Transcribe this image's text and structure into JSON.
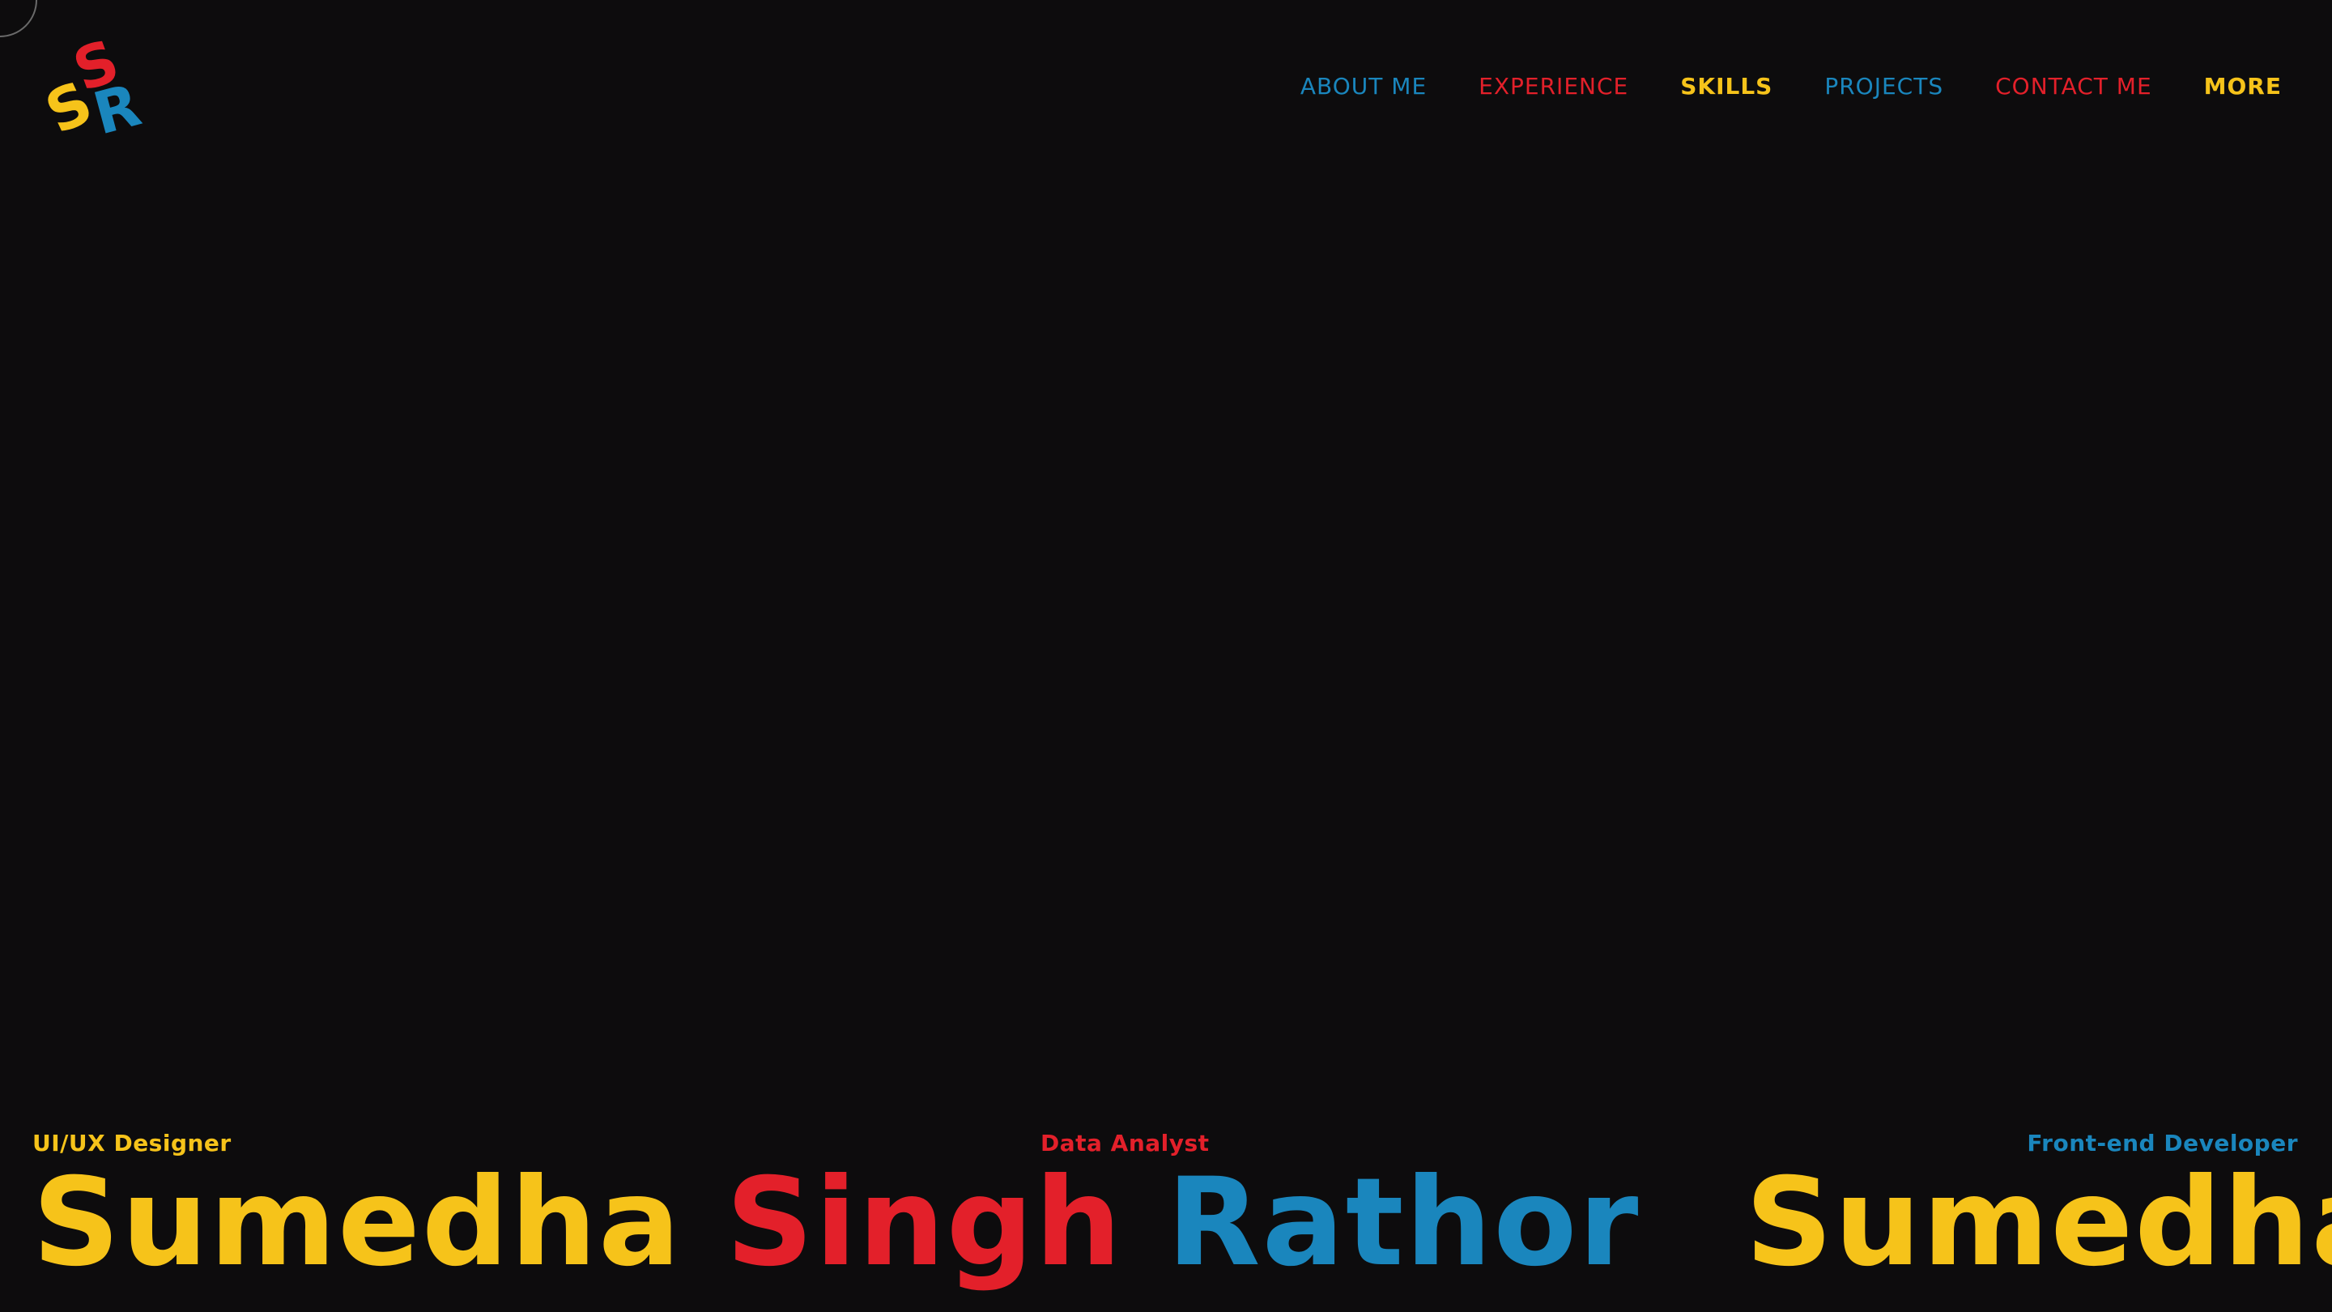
{
  "colors": {
    "background": "#0d0c0d",
    "yellow": "#f6c31a",
    "red": "#e3202a",
    "blue": "#1a86bd"
  },
  "logo": {
    "letters": [
      "S",
      "S",
      "R"
    ]
  },
  "nav": {
    "items": [
      {
        "label": "ABOUT ME",
        "color": "blue"
      },
      {
        "label": "EXPERIENCE",
        "color": "red"
      },
      {
        "label": "SKILLS",
        "color": "yellow"
      },
      {
        "label": "PROJECTS",
        "color": "blue"
      },
      {
        "label": "CONTACT ME",
        "color": "red"
      },
      {
        "label": "MORE",
        "color": "yellow"
      }
    ]
  },
  "roles": {
    "left": "UI/UX Designer",
    "center": "Data Analyst",
    "right": "Front-end Developer"
  },
  "name": {
    "first": "Sumedha",
    "middle": "Singh",
    "last": "Rathor"
  }
}
